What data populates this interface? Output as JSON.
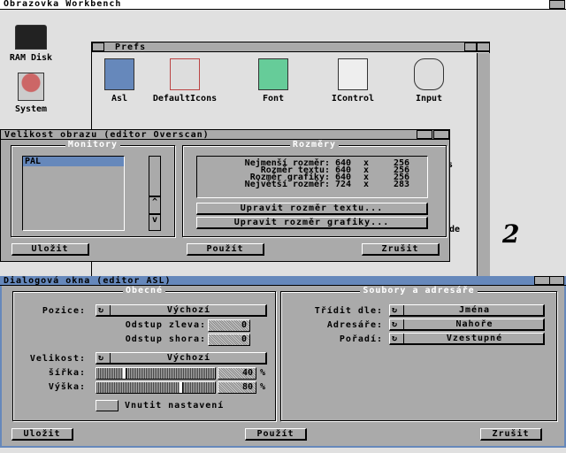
{
  "screen": {
    "title": "Obrazovka Workbench"
  },
  "desktop": {
    "icons": [
      {
        "label": "RAM Disk",
        "icon": "ram-disk-icon"
      },
      {
        "label": "System",
        "icon": "system-drawer-icon"
      }
    ],
    "stray_text": [
      "s",
      "de"
    ],
    "digit": "2"
  },
  "prefs": {
    "title": "Prefs",
    "icons": [
      {
        "label": "Asl",
        "icon": "asl-icon"
      },
      {
        "label": "DefaultIcons",
        "icon": "defaulticons-icon"
      },
      {
        "label": "Font",
        "icon": "font-icon"
      },
      {
        "label": "IControl",
        "icon": "icontrol-icon"
      },
      {
        "label": "Input",
        "icon": "input-icon"
      }
    ]
  },
  "overscan": {
    "title": "Velikost obrazu (editor Overscan)",
    "monitors_label": "Monitory",
    "monitors": [
      "PAL"
    ],
    "sizes_label": "Rozměry",
    "rows": [
      {
        "label": "Nejmenší rozměr:",
        "w": "640",
        "x": "x",
        "h": "256"
      },
      {
        "label": "Rozměr textu:",
        "w": "640",
        "x": "x",
        "h": "256"
      },
      {
        "label": "Rozměr grafiky:",
        "w": "640",
        "x": "x",
        "h": "256"
      },
      {
        "label": "Největší rozměr:",
        "w": "724",
        "x": "x",
        "h": "283"
      }
    ],
    "edit_text": "Upravit rozměr textu...",
    "edit_gfx": "Upravit rozměr grafiky...",
    "save": "Uložit",
    "use": "Použít",
    "cancel": "Zrušit"
  },
  "asl": {
    "title": "Dialogová okna (editor ASL)",
    "general_label": "Obecné",
    "files_label": "Soubory a adresáře",
    "position_label": "Pozice:",
    "position_value": "Výchozí",
    "left_label": "Odstup zleva:",
    "left_value": "0",
    "top_label": "Odstup shora:",
    "top_value": "0",
    "size_label": "Velikost:",
    "size_value": "Výchozí",
    "width_label": "šířka:",
    "width_value": "40",
    "width_level_percent": 23,
    "height_label": "Výška:",
    "height_value": "80",
    "height_level_percent": 72,
    "percent": "%",
    "force_label": "Vnutit nastavení",
    "force_checked": false,
    "sort_label": "Třídit dle:",
    "sort_value": "Jména",
    "dirs_label": "Adresáře:",
    "dirs_value": "Nahoře",
    "order_label": "Pořadí:",
    "order_value": "Vzestupné",
    "save": "Uložit",
    "use": "Použít",
    "cancel": "Zrušit"
  },
  "colors": {
    "active_title": "#6688bb",
    "window_bg": "#aaaaaa",
    "desktop": "#e0e0e0"
  }
}
